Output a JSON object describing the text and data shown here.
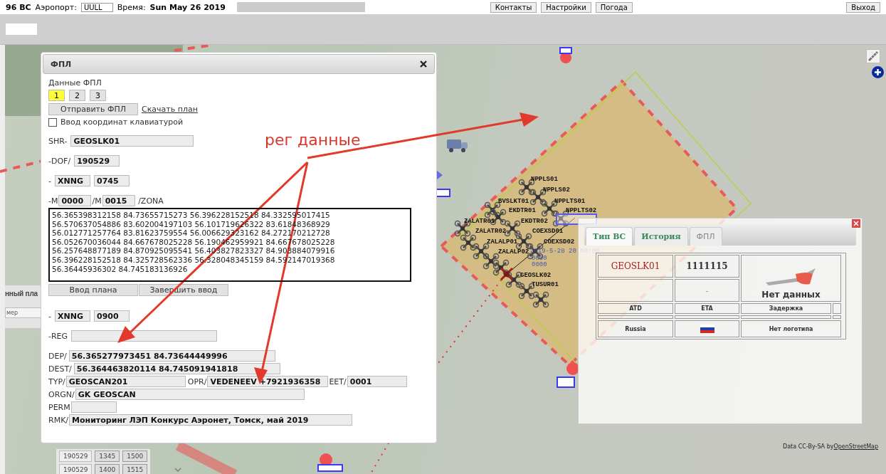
{
  "top_bar": {
    "count": "96 ВС",
    "airport_label": "Аэропорт:",
    "airport": "UULL",
    "time_label": "Время:",
    "time": "Sun May 26 2019",
    "buttons": [
      "Контакты",
      "Настройки",
      "Погода"
    ],
    "exit": "Выход"
  },
  "left_panel": {
    "title": "нный пла",
    "column": "мер",
    "rows": [
      [
        "190529",
        "1345",
        "1500"
      ],
      [
        "190529",
        "1400",
        "1515"
      ]
    ]
  },
  "fpl": {
    "title": "ФПЛ",
    "section_label": "Данные ФПЛ",
    "tabs": [
      {
        "label": "1",
        "selected": true
      },
      {
        "label": "2",
        "selected": false
      },
      {
        "label": "3",
        "selected": false
      }
    ],
    "send_button": "Отправить ФПЛ",
    "download_link": "Скачать план",
    "keyboard_entry": {
      "label": "Ввод координат клавиатурой",
      "checked": false
    },
    "shr": {
      "label": "SHR-",
      "value": "GEOSLK01"
    },
    "dof": {
      "label": "-DOF/",
      "value": "190529"
    },
    "departure": {
      "prefix": "-",
      "aerodrome": "XNNG",
      "time": "0745"
    },
    "altitude": {
      "min_label": "-M",
      "min": "0000",
      "max_label": "/M",
      "max": "0015",
      "suffix": "/ZONA"
    },
    "zone_coordinates": [
      "56.365398312158 84.73655715273 56.396228152518 84.332595017415",
      "56.570637054886 83.602004197103 56.101719626322 83.61848368929",
      "56.012771257764 83.81623759554 56.006629323162 84.272170212728",
      "56.052670036044 84.667678025228 56.190462959921 84.667678025228",
      "56.257648877189 84.870925095541 56.403827823327 84.903884079916",
      "56.396228152518 84.325728562336 56.328048345159 84.592147019368",
      "56.36445936302 84.745183136926"
    ],
    "plan_buttons": [
      "Ввод плана",
      "Завершить ввод"
    ],
    "arrival": {
      "prefix": "-",
      "aerodrome": "XNNG",
      "time": "0900"
    },
    "reg": {
      "label": "-REG"
    },
    "dep": {
      "label": "DEP/",
      "value": "56.365277973451 84.73644449996"
    },
    "dest": {
      "label": "DEST/",
      "value": "56.364463820114 84.745091941818"
    },
    "typ": {
      "label": "TYP/",
      "value": "GEOSCAN201"
    },
    "opr": {
      "label": "OPR/",
      "value": "VEDENEEV +7921936358"
    },
    "eet": {
      "label": "EET/",
      "value": "0001"
    },
    "orgn": {
      "label": "ORGN/",
      "value": "GK GEOSCAN"
    },
    "perm": {
      "label": "PERM"
    },
    "rmk": {
      "label": "RMK/",
      "value": "Мониторинг ЛЭП Конкурс Аэронет, Томск, май 2019"
    }
  },
  "map": {
    "drones": [
      "NPPLS01",
      "NPPLS02",
      "BVSLKT01",
      "NPPLTS01",
      "EKDTR01",
      "NPPLTS02",
      "ZALATR01",
      "EKDTR02",
      "ZALATR02",
      "COEXSD01",
      "ZALALP01",
      "COEXSD02",
      "ZALALP02",
      "GEOSLK02",
      "TUSUR01"
    ],
    "track_labels": [
      "2019-5-28 20:00:00",
      "0000",
      "0000"
    ],
    "attribution": {
      "text": "Data CC-By-SA by",
      "link": "OpenStreetMap"
    }
  },
  "annotation": {
    "text": "рег данные"
  },
  "info_panel": {
    "tabs": [
      {
        "label": "Тип ВС",
        "selected": true
      },
      {
        "label": "История",
        "selected": false
      },
      {
        "label": "ФПЛ",
        "selected": false
      }
    ],
    "callsign": "GEOSLK01",
    "number": "1111115",
    "second_value": "-",
    "status": "Нет данных",
    "headers": [
      "ATD",
      "ETA",
      "Задержка"
    ],
    "country": "Russia",
    "logo": "Нет логотипа"
  }
}
